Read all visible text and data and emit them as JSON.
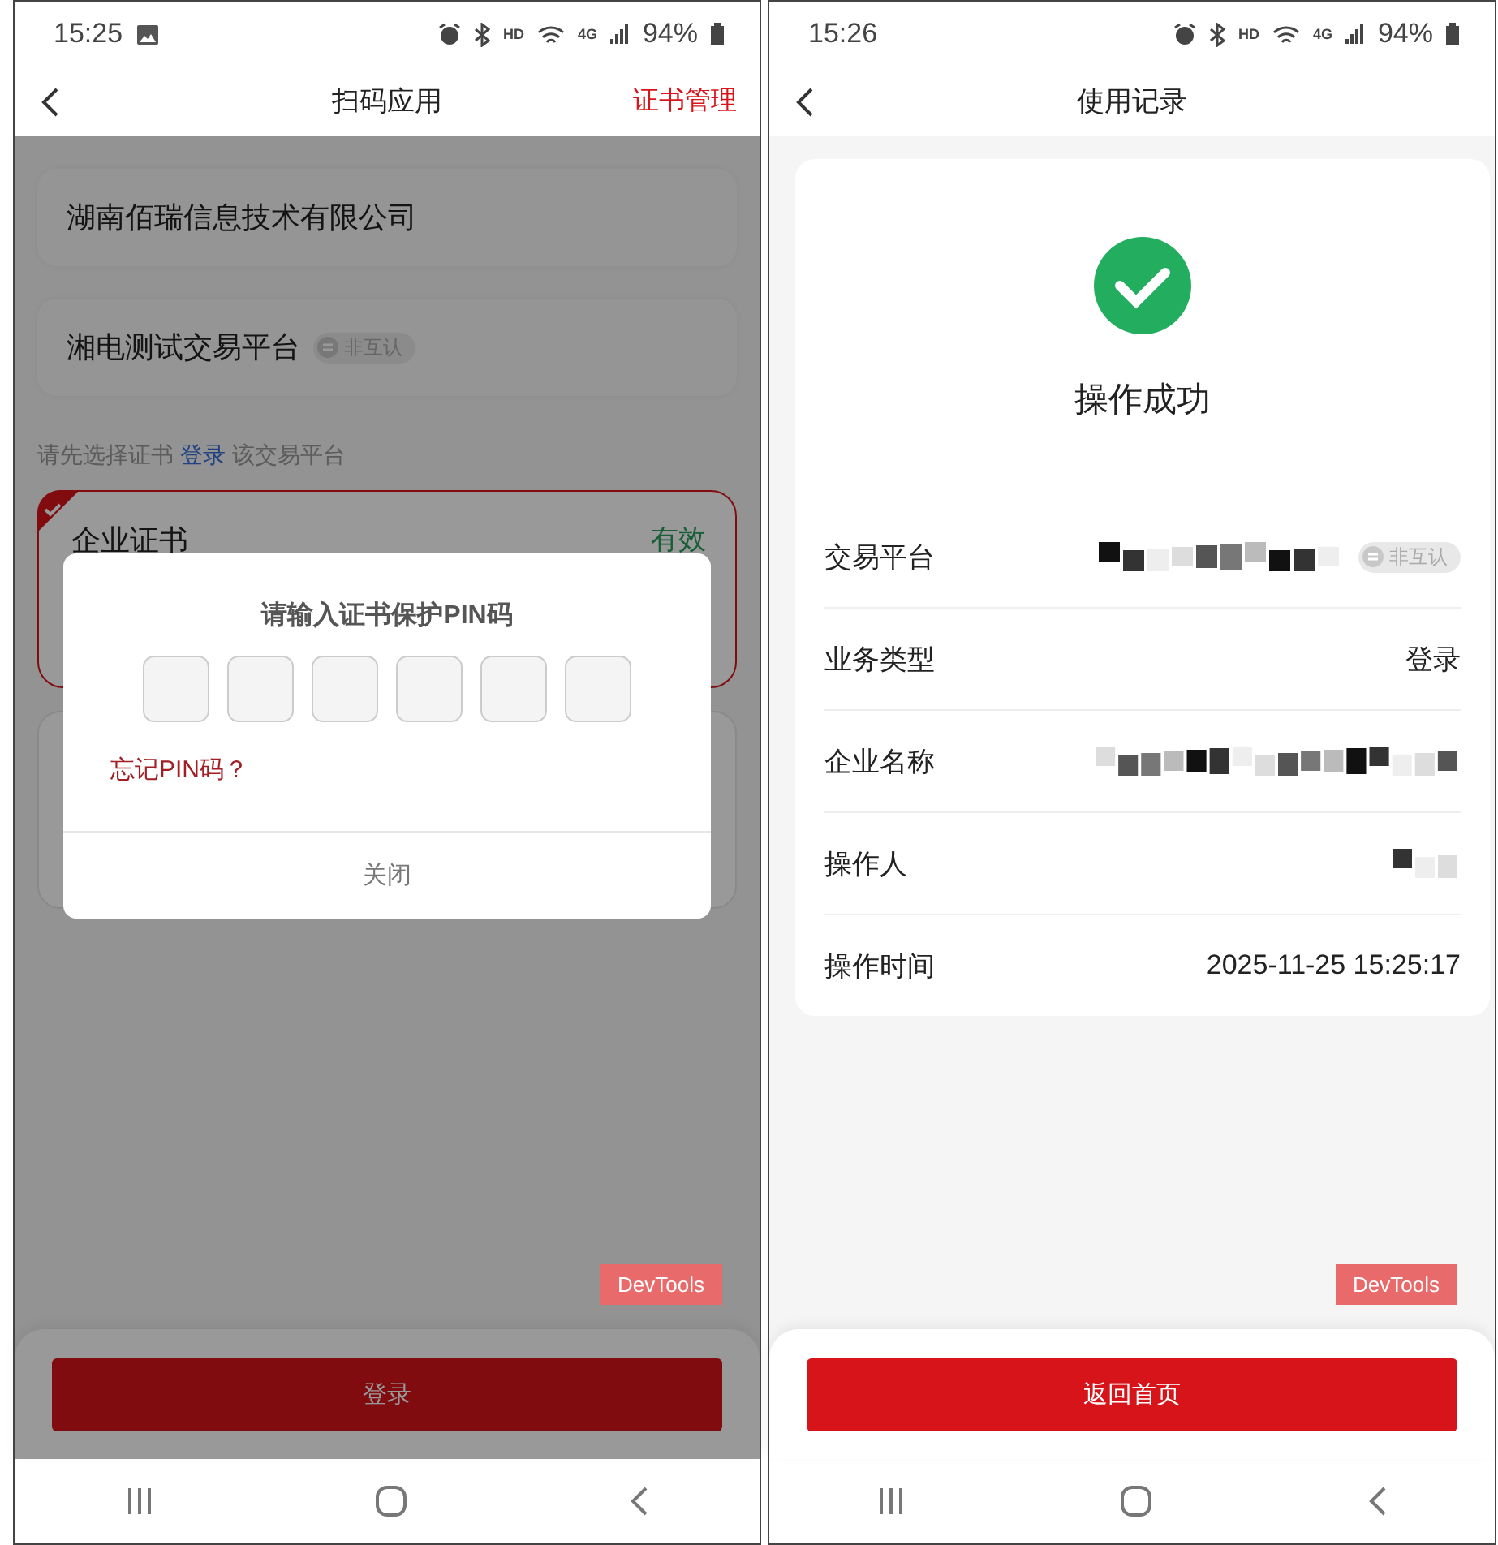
{
  "screens": [
    {
      "kind": "scan",
      "status_bar": {
        "time": "15:25",
        "gallery_notification": true,
        "hd": "HD",
        "network": "4G",
        "battery": "94%"
      },
      "header": {
        "title": "扫码应用",
        "action": "证书管理"
      },
      "company": "湖南佰瑞信息技术有限公司",
      "platform": {
        "name": "湘电测试交易平台",
        "badge": "非互认"
      },
      "hint": {
        "before": "请先选择证书",
        "link": "登录",
        "after": "该交易平台"
      },
      "certificate": {
        "name": "企业证书",
        "status": "有效",
        "selected": true
      },
      "dialog": {
        "title": "请输入证书保护PIN码",
        "pin_fields": [
          {
            "filled": false
          },
          {
            "filled": false
          },
          {
            "filled": false
          },
          {
            "filled": false
          },
          {
            "filled": false
          },
          {
            "filled": false
          }
        ],
        "forgot": "忘记PIN码？",
        "close": "关闭"
      },
      "devtools": "DevTools",
      "primary_button": "登录"
    },
    {
      "kind": "record",
      "status_bar": {
        "time": "15:26",
        "gallery_notification": false,
        "hd": "HD",
        "network": "4G",
        "battery": "94%"
      },
      "header": {
        "title": "使用记录"
      },
      "result": {
        "title": "操作成功",
        "success": true
      },
      "rows": [
        {
          "label": "交易平台",
          "redacted": true,
          "badge": "非互认"
        },
        {
          "label": "业务类型",
          "redacted": false,
          "value": "登录"
        },
        {
          "label": "企业名称",
          "redacted": true
        },
        {
          "label": "操作人",
          "redacted": true
        },
        {
          "label": "操作时间",
          "redacted": false,
          "value": "2025-11-25 15:25:17"
        }
      ],
      "devtools": "DevTools",
      "primary_button": "返回首页"
    }
  ]
}
